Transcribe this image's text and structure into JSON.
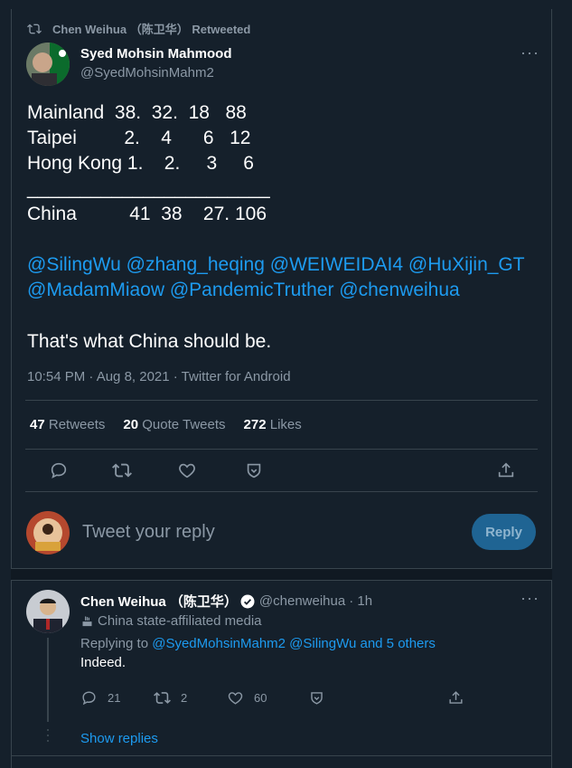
{
  "retweet_banner": "Chen Weihua （陈卫华） Retweeted",
  "tweet": {
    "author_name": "Syed Mohsin Mahmood",
    "author_handle": "@SyedMohsinMahm2",
    "lines": [
      "Mainland  38.  32.  18   88",
      "Taipei         2.    4      6   12",
      "Hong Kong 1.    2.     3     6",
      "_______________________",
      "China          41  38    27. 106"
    ],
    "mentions_line1": "@SilingWu @zhang_heqing @WEIWEIDAI4 @HuXijin_GT",
    "mentions_line2": "@MadamMiaow @PandemicTruther @chenweihua",
    "closing": "That's what China should be.",
    "meta": "10:54 PM · Aug 8, 2021 · Twitter for Android",
    "retweets_count": "47",
    "retweets_label": "Retweets",
    "quotes_count": "20",
    "quotes_label": "Quote Tweets",
    "likes_count": "272",
    "likes_label": "Likes"
  },
  "composer": {
    "placeholder": "Tweet your reply",
    "reply_button": "Reply"
  },
  "reply": {
    "author_name": "Chen Weihua （陈卫华）",
    "author_handle": "@chenweihua",
    "time": "· 1h",
    "affiliation": "China state-affiliated media",
    "replying_prefix": "Replying to",
    "replying_to": "@SyedMohsinMahm2 @SilingWu and 5 others",
    "text": "Indeed.",
    "reply_count": "21",
    "retweet_count": "2",
    "like_count": "60",
    "show_replies": "Show replies"
  },
  "colors": {
    "background": "#15202b",
    "accent": "#1d9bf0",
    "muted": "#8b98a5",
    "border": "#38444d"
  }
}
